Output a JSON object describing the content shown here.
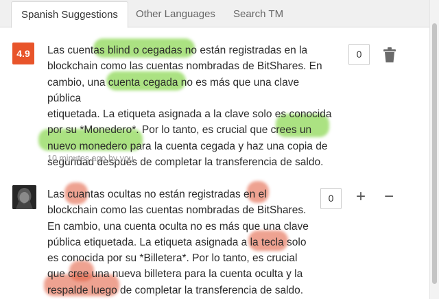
{
  "tabs": [
    {
      "label": "Spanish Suggestions",
      "active": true
    },
    {
      "label": "Other Languages",
      "active": false
    },
    {
      "label": "Search TM",
      "active": false
    }
  ],
  "suggestions": [
    {
      "score": "4.9",
      "text": "Las cuentas blind o cegadas no están registradas en la\nblockchain como las cuentas nombradas de BitShares. En\ncambio, una cuenta cegada no es más que una clave pública\netiquetada. La etiqueta asignada a la clave solo es conocida\npor su *Monedero*. Por lo tanto, es crucial que crees un\nnuevo monedero para la cuenta cegada y haz una copia de\nseguridad después de completar la transferencia de saldo.",
      "meta": "10 minutes ago by you",
      "votes": "0",
      "actions": {
        "delete_icon": "trash-icon"
      }
    },
    {
      "text": "Las cuantas ocultas no están registradas en el\nblockchain como las cuentas nombradas de BitShares.\nEn cambio, una cuenta oculta no es más que una clave\npública etiquetada. La etiqueta asignada a la tecla solo\nes conocida por su *Billetera*. Por lo tanto, es crucial\nque cree una nueva billetera para la cuenta oculta y la\nrespalde luego de completar la transferencia de saldo.",
      "votes": "0",
      "actions": {
        "upvote": "+",
        "downvote": "−"
      }
    }
  ],
  "colors": {
    "score_badge": "#e8542a",
    "highlight_good": "#6ecd28",
    "highlight_bad": "#e15f41"
  }
}
